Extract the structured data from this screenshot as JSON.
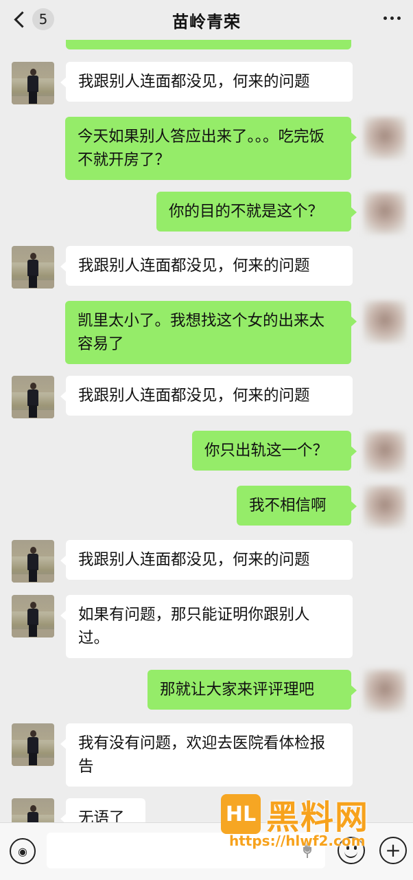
{
  "header": {
    "title": "苗岭青荣",
    "unread_count": "5"
  },
  "messages": [
    {
      "side": "left",
      "text": "我跟别人连面都没见，何来的问题"
    },
    {
      "side": "right",
      "text": "今天如果别人答应出来了。。。吃完饭不就开房了？"
    },
    {
      "side": "right",
      "text": "你的目的不就是这个？"
    },
    {
      "side": "left",
      "text": "我跟别人连面都没见，何来的问题"
    },
    {
      "side": "right",
      "text": "凯里太小了。我想找这个女的出来太容易了"
    },
    {
      "side": "left",
      "text": "我跟别人连面都没见，何来的问题"
    },
    {
      "side": "right",
      "text": "你只出轨这一个？"
    },
    {
      "side": "right",
      "text": "我不相信啊"
    },
    {
      "side": "left",
      "text": "我跟别人连面都没见，何来的问题"
    },
    {
      "side": "left",
      "text": "如果有问题，那只能证明你跟别人过。"
    },
    {
      "side": "right",
      "text": "那就让大家来评评理吧"
    },
    {
      "side": "left",
      "text": "我有没有问题，欢迎去医院看体检报告"
    },
    {
      "side": "left",
      "text": "无语了"
    }
  ],
  "icons": {
    "back": "chevron-left-icon",
    "more": "more-dots-icon",
    "voice": "voice-icon",
    "mic": "mic-icon",
    "emoji": "emoji-icon",
    "plus": "plus-icon"
  },
  "colors": {
    "background": "#ededed",
    "bubble_self": "#95ec69",
    "bubble_other": "#ffffff",
    "watermark": "#f7a21c"
  },
  "watermark": {
    "logo_text": "HL",
    "title": "黑料网",
    "url": "https://hlwf2.com"
  }
}
